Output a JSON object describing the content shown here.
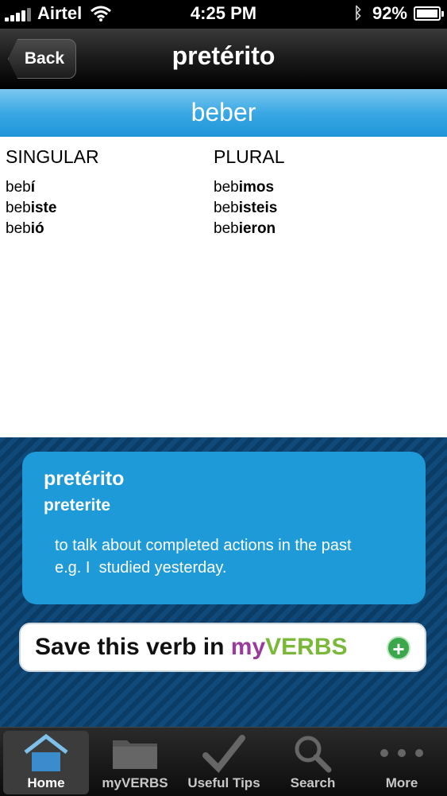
{
  "status": {
    "carrier": "Airtel",
    "time": "4:25 PM",
    "battery": "92%"
  },
  "nav": {
    "back_label": "Back",
    "title": "pretérito"
  },
  "verb": "beber",
  "conjugation": {
    "singular_header": "SINGULAR",
    "plural_header": "PLURAL",
    "singular": [
      {
        "stem": "beb",
        "ending": "í"
      },
      {
        "stem": "beb",
        "ending": "iste"
      },
      {
        "stem": "beb",
        "ending": "ió"
      }
    ],
    "plural": [
      {
        "stem": "beb",
        "ending": "imos"
      },
      {
        "stem": "beb",
        "ending": "isteis"
      },
      {
        "stem": "beb",
        "ending": "ieron"
      }
    ]
  },
  "info": {
    "tense_name": "pretérito",
    "tense_english": "preterite",
    "desc_line1": "to talk about completed actions in the past",
    "desc_line2": "e.g. I  studied yesterday."
  },
  "save": {
    "prefix": "Save this verb in ",
    "my": "my",
    "verbs": "VERBS"
  },
  "tabs": [
    {
      "label": "Home",
      "icon": "home-icon",
      "active": true
    },
    {
      "label": "myVERBS",
      "icon": "folder-icon",
      "active": false
    },
    {
      "label": "Useful Tips",
      "icon": "checkmark-icon",
      "active": false
    },
    {
      "label": "Search",
      "icon": "search-icon",
      "active": false
    },
    {
      "label": "More",
      "icon": "more-dots-icon",
      "active": false
    }
  ]
}
